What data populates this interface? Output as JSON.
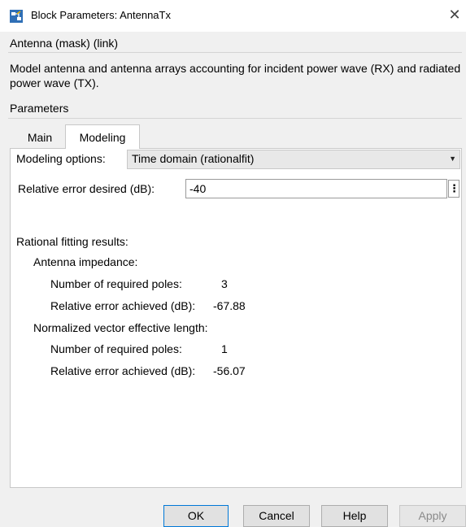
{
  "window": {
    "title": "Block Parameters: AntennaTx",
    "close_glyph": "✕",
    "icon": "simulink-block-icon"
  },
  "header": {
    "block_name": "Antenna (mask) (link)",
    "description": "Model antenna and antenna arrays accounting for incident power wave (RX) and radiated power wave (TX)."
  },
  "parameters": {
    "label": "Parameters",
    "tabs": [
      {
        "label": "Main",
        "active": false
      },
      {
        "label": "Modeling",
        "active": true
      }
    ]
  },
  "modeling": {
    "options_label": "Modeling options:",
    "options_value": "Time domain (rationalfit)",
    "relative_error_label": "Relative error desired (dB):",
    "relative_error_value": "-40",
    "results_heading": "Rational fitting results:",
    "antenna_impedance": {
      "heading": "Antenna impedance:",
      "poles_label": "Number of required poles:",
      "poles_value": "3",
      "error_label": "Relative error achieved (dB):",
      "error_value": "-67.88"
    },
    "vector_length": {
      "heading": "Normalized vector effective length:",
      "poles_label": "Number of required poles:",
      "poles_value": "1",
      "error_label": "Relative error achieved (dB):",
      "error_value": "-56.07"
    }
  },
  "buttons": {
    "ok": "OK",
    "cancel": "Cancel",
    "help": "Help",
    "apply": "Apply"
  },
  "colors": {
    "accent": "#0078d7",
    "background": "#f0f0f0"
  }
}
